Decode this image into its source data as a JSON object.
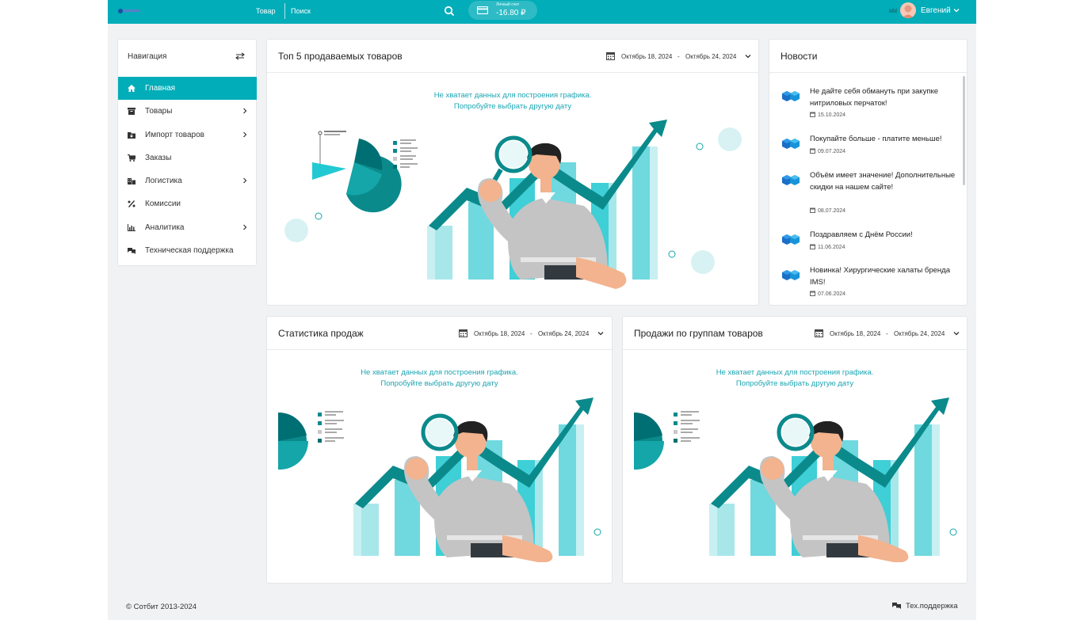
{
  "header": {
    "nav_links": [
      "Товар",
      "Поиск"
    ],
    "balance_label": "Личный счет",
    "balance_value": "-16.80 ₽",
    "user_name": "Евгений",
    "bg_color": "#00adb9"
  },
  "sidebar": {
    "title": "Навигация",
    "items": [
      {
        "label": "Главная",
        "icon": "home-icon",
        "active": true,
        "has_submenu": false
      },
      {
        "label": "Товары",
        "icon": "box-icon",
        "active": false,
        "has_submenu": true
      },
      {
        "label": "Импорт товаров",
        "icon": "import-icon",
        "active": false,
        "has_submenu": true
      },
      {
        "label": "Заказы",
        "icon": "cart-icon",
        "active": false,
        "has_submenu": false
      },
      {
        "label": "Логистика",
        "icon": "building-icon",
        "active": false,
        "has_submenu": true
      },
      {
        "label": "Комиссии",
        "icon": "percent-icon",
        "active": false,
        "has_submenu": false
      },
      {
        "label": "Аналитика",
        "icon": "bar-chart-icon",
        "active": false,
        "has_submenu": true
      },
      {
        "label": "Техническая поддержка",
        "icon": "chat-icon",
        "active": false,
        "has_submenu": false
      }
    ]
  },
  "top5": {
    "title": "Топ 5 продаваемых товаров",
    "date_from": "Октябрь 18, 2024",
    "date_to": "Октябрь 24, 2024",
    "nodata_line1": "Не хватает данных для построения графика.",
    "nodata_line2": "Попробуйте выбрать другую дату"
  },
  "sales_stats": {
    "title": "Статистика продаж",
    "date_from": "Октябрь 18, 2024",
    "date_to": "Октябрь 24, 2024",
    "nodata_line1": "Не хватает данных для построения графика.",
    "nodata_line2": "Попробуйте выбрать другую дату"
  },
  "sales_groups": {
    "title": "Продажи по группам товаров",
    "date_from": "Октябрь 18, 2024",
    "date_to": "Октябрь 24, 2024",
    "nodata_line1": "Не хватает данных для построения графика.",
    "nodata_line2": "Попробуйте выбрать другую дату"
  },
  "news": {
    "title": "Новости",
    "items": [
      {
        "title": "Не дайте себя обмануть при закупке нитриловых перчаток!",
        "date": "15.10.2024"
      },
      {
        "title": "Покупайте больше - платите меньше!",
        "date": "09.07.2024"
      },
      {
        "title": "Объём имеет значение! Дополнительные скидки на нашем сайте!",
        "date": "08.07.2024"
      },
      {
        "title": "Поздравляем с Днём России!",
        "date": "11.06.2024"
      },
      {
        "title": "Новинка! Хирургические халаты бренда IMS!",
        "date": "07.06.2024"
      }
    ]
  },
  "footer": {
    "copyright": "© Сотбит 2013-2024",
    "support": "Тех.поддержка"
  },
  "colors": {
    "accent": "#00adb9",
    "teal_dark": "#0b8a8c",
    "teal_light": "#6fd9df"
  }
}
